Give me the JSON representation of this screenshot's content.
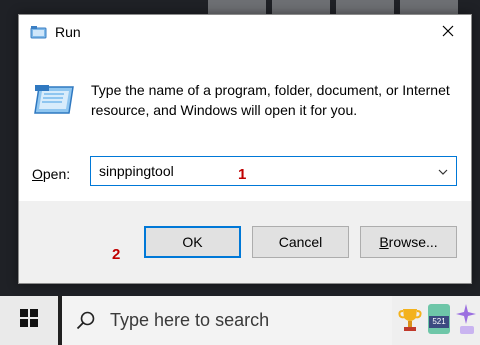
{
  "dialog": {
    "title": "Run",
    "description": "Type the name of a program, folder, document, or Internet resource, and Windows will open it for you.",
    "open_label_accel": "O",
    "open_label_rest": "pen:",
    "open_value": "sinppingtool",
    "annotation_1": "1",
    "annotation_2": "2",
    "ok_label": "OK",
    "cancel_label": "Cancel",
    "browse_accel": "B",
    "browse_rest": "rowse..."
  },
  "taskbar": {
    "search_placeholder": "Type here to search",
    "badge_text": "521"
  },
  "colors": {
    "accent": "#0078d7",
    "annotation": "#c00000",
    "dialog_bg": "#f0f0f0",
    "taskbar_bg": "#202020"
  },
  "icons": [
    "run-app-icon",
    "close-icon",
    "chevron-down-icon",
    "windows-logo-icon",
    "search-icon",
    "trophy-icon",
    "badge-icon",
    "sparkle-icon"
  ]
}
